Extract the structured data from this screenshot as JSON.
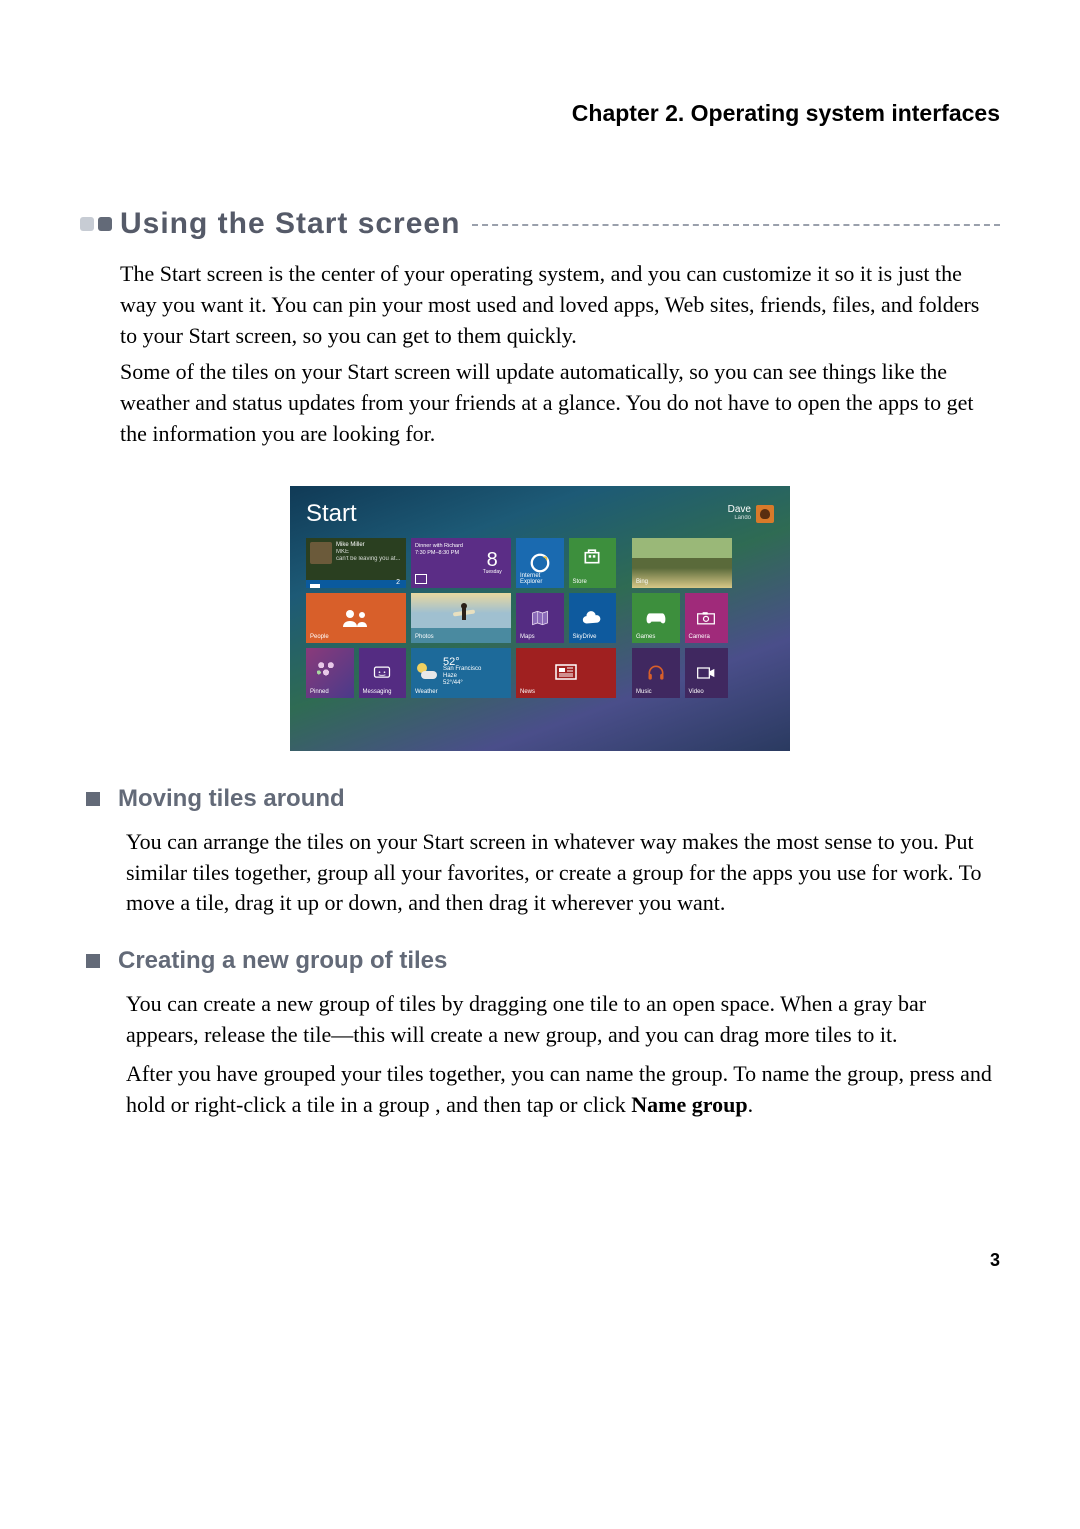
{
  "chapter": "Chapter 2. Operating system interfaces",
  "section": {
    "title": "Using the Start screen",
    "para1": "The Start screen is the center of your operating system, and you can customize it so it is just the way you want it. You can pin your most used and loved apps, Web sites, friends, files, and folders to your Start screen, so you can get to them quickly.",
    "para2": "Some of the tiles on your Start screen will update automatically, so you can see things like the weather and status updates from your friends at a glance. You do not have to open the apps to get the information you are looking for."
  },
  "screenshot": {
    "start_label": "Start",
    "user_name": "Dave",
    "user_sub": "Lando",
    "tiles": {
      "mail": {
        "name": "Mike Miller",
        "status_line1": "MKE",
        "status_line2": "can't be leaving you at...",
        "badge": "2"
      },
      "calendar": {
        "event": "Dinner with Richard",
        "time": "7:30 PM–8:30 PM",
        "day_num": "8",
        "day_name": "Tuesday"
      },
      "ie": {
        "label": "Internet Explorer"
      },
      "store": {
        "label": "Store"
      },
      "people": {
        "label": "People"
      },
      "photos": {
        "label": "Photos"
      },
      "maps": {
        "label": "Maps"
      },
      "skydrive": {
        "label": "SkyDrive"
      },
      "pinned": {
        "label": "Pinned"
      },
      "messaging": {
        "label": "Messaging"
      },
      "weather": {
        "label": "Weather",
        "temp": "52°",
        "city": "San Francisco",
        "cond1": "Haze",
        "cond2": "52°/44°"
      },
      "news": {
        "label": "News"
      },
      "bing": {
        "label": "Bing"
      },
      "games": {
        "label": "Games"
      },
      "camera": {
        "label": "Camera"
      },
      "music": {
        "label": "Music"
      },
      "video": {
        "label": "Video"
      }
    }
  },
  "sub1": {
    "title": "Moving tiles around",
    "para": "You can arrange the tiles on your Start screen in whatever way makes the most sense to you. Put similar tiles together, group all your favorites, or create a group for the apps you use for work. To move a tile, drag it up or down, and then drag it wherever you want."
  },
  "sub2": {
    "title": "Creating a new group of tiles",
    "para1": "You can create a new group of tiles by dragging one tile to an open space. When a gray bar appears, release the tile—this will create a new group, and you can drag more tiles to it.",
    "para2a": "After you have grouped your tiles together, you can name the group. To name the group, press and hold or right-click a tile in a group , and then tap or click ",
    "para2b": "Name group",
    "para2c": "."
  },
  "page_number": "3"
}
